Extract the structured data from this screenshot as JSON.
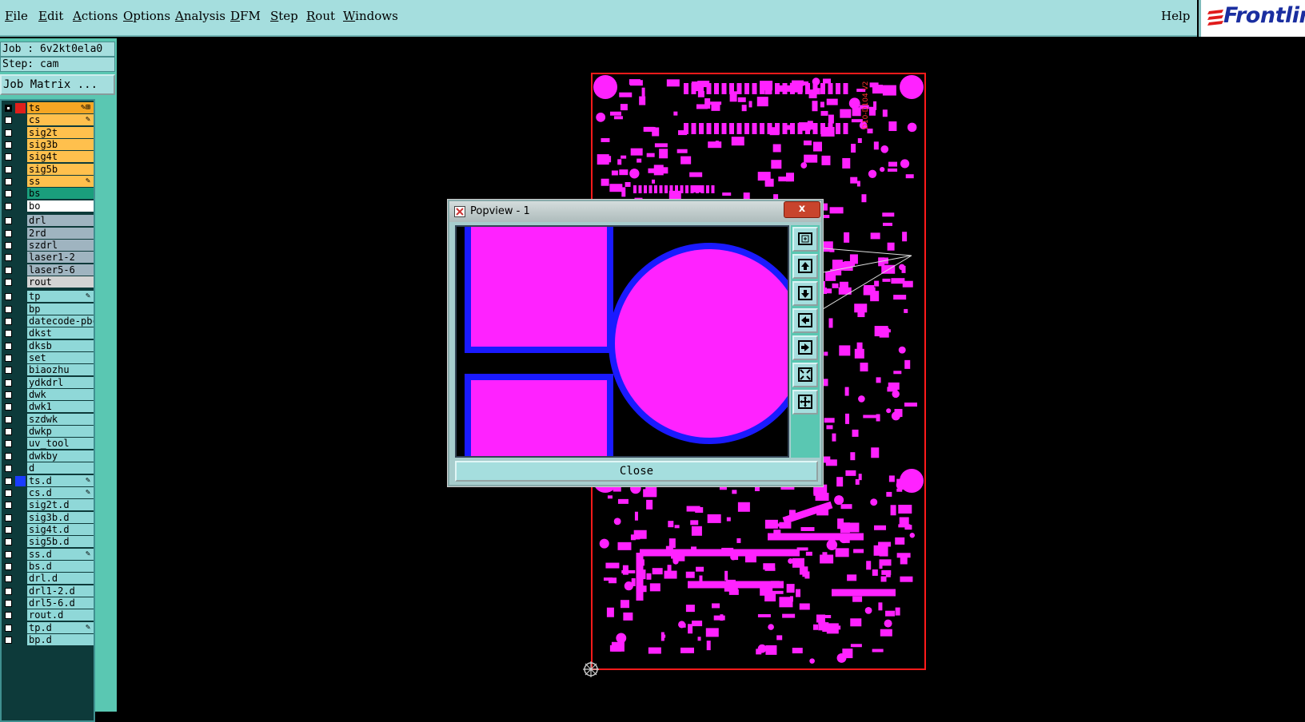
{
  "menubar": {
    "items": [
      "File",
      "Edit",
      "Actions",
      "Options",
      "Analysis",
      "DFM",
      "Step",
      "Rout",
      "Windows"
    ],
    "help": "Help",
    "logo": "Frontline"
  },
  "job": {
    "job_label": "Job : 6v2kt0ela0",
    "step_label": "Step: cam",
    "matrix_button": "Job Matrix ..."
  },
  "layers": [
    {
      "name": "ts",
      "color": "#f5a623",
      "swatch": "#e0201c",
      "mark": "✎⊞",
      "sel": true,
      "dark": true
    },
    {
      "name": "cs",
      "color": "#ffc04d",
      "mark": "✎"
    },
    {
      "name": "sig2t",
      "color": "#ffc04d"
    },
    {
      "name": "sig3b",
      "color": "#ffc04d"
    },
    {
      "name": "sig4t",
      "color": "#ffc04d"
    },
    {
      "name": "sig5b",
      "color": "#ffc04d"
    },
    {
      "name": "ss",
      "color": "#ffc04d",
      "mark": "✎"
    },
    {
      "name": "bs",
      "color": "#1a9e7c"
    },
    {
      "name": "bo",
      "color": "#ffffff"
    },
    {
      "gap": true
    },
    {
      "name": "drl",
      "color": "#9fb4c0"
    },
    {
      "name": "2rd",
      "color": "#9fb4c0"
    },
    {
      "name": "szdrl",
      "color": "#9fb4c0"
    },
    {
      "name": "laser1-2",
      "color": "#9fb4c0"
    },
    {
      "name": "laser5-6",
      "color": "#9fb4c0"
    },
    {
      "name": "rout",
      "color": "#d3d3d3"
    },
    {
      "gap": true
    },
    {
      "name": "tp",
      "color": "#8fd8d8",
      "mark": "✎"
    },
    {
      "name": "bp",
      "color": "#8fd8d8"
    },
    {
      "name": "datecode-pbc",
      "color": "#8fd8d8"
    },
    {
      "name": "dkst",
      "color": "#8fd8d8"
    },
    {
      "name": "dksb",
      "color": "#8fd8d8"
    },
    {
      "name": "set",
      "color": "#8fd8d8"
    },
    {
      "name": "biaozhu",
      "color": "#8fd8d8"
    },
    {
      "name": "ydkdrl",
      "color": "#8fd8d8"
    },
    {
      "name": "dwk",
      "color": "#8fd8d8"
    },
    {
      "name": "dwk1",
      "color": "#8fd8d8"
    },
    {
      "name": "szdwk",
      "color": "#8fd8d8"
    },
    {
      "name": "dwkp",
      "color": "#8fd8d8"
    },
    {
      "name": "uv_tool",
      "color": "#8fd8d8"
    },
    {
      "name": "dwkby",
      "color": "#8fd8d8"
    },
    {
      "name": "d",
      "color": "#8fd8d8"
    },
    {
      "name": "ts.d",
      "color": "#8fd8d8",
      "swatch": "#1a3cff",
      "mark": "✎"
    },
    {
      "name": "cs.d",
      "color": "#8fd8d8",
      "mark": "✎"
    },
    {
      "name": "sig2t.d",
      "color": "#8fd8d8"
    },
    {
      "name": "sig3b.d",
      "color": "#8fd8d8"
    },
    {
      "name": "sig4t.d",
      "color": "#8fd8d8"
    },
    {
      "name": "sig5b.d",
      "color": "#8fd8d8"
    },
    {
      "name": "ss.d",
      "color": "#8fd8d8",
      "mark": "✎"
    },
    {
      "name": "bs.d",
      "color": "#8fd8d8"
    },
    {
      "name": "drl.d",
      "color": "#8fd8d8"
    },
    {
      "name": "drl1-2.d",
      "color": "#8fd8d8"
    },
    {
      "name": "drl5-6.d",
      "color": "#8fd8d8"
    },
    {
      "name": "rout.d",
      "color": "#8fd8d8"
    },
    {
      "name": "tp.d",
      "color": "#8fd8d8",
      "mark": "✎"
    },
    {
      "name": "bp.d",
      "color": "#8fd8d8"
    }
  ],
  "board": {
    "outline_color": "#ff1a1a",
    "copper_color": "#ff22ff",
    "label": "D10-D104 V2"
  },
  "popview": {
    "title": "Popview - 1",
    "close_x": "x",
    "close_button": "Close",
    "pad_color": "#ff22ff",
    "clearance_color": "#1a1aff"
  }
}
